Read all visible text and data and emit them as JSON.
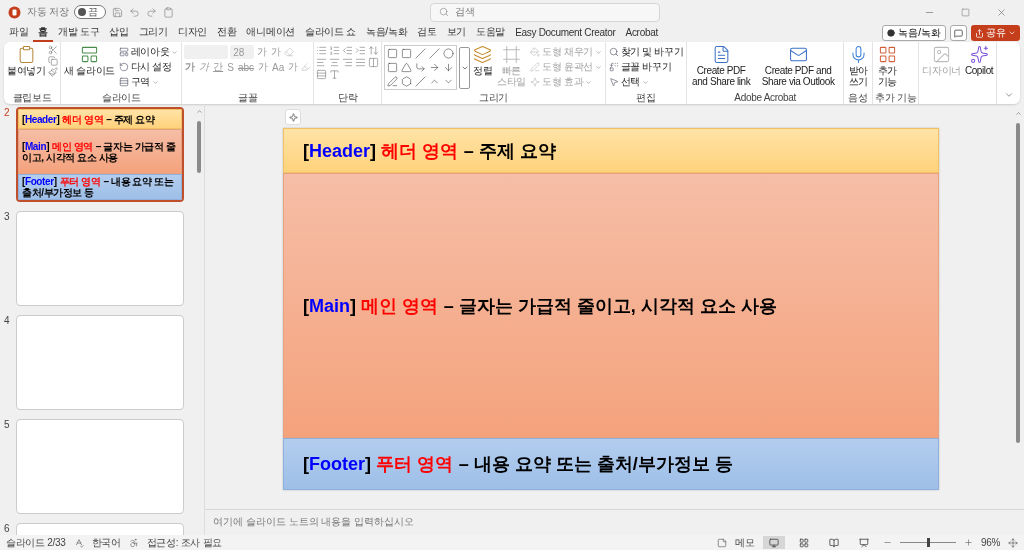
{
  "titlebar": {
    "autosave_label": "자동 저장",
    "autosave": {
      "on": false,
      "label": "끔"
    },
    "search": {
      "placeholder": "검색"
    }
  },
  "menu": [
    {
      "label": "파일",
      "selected": false
    },
    {
      "label": "홈",
      "selected": true
    },
    {
      "label": "개발 도구",
      "selected": false
    },
    {
      "label": "삽입",
      "selected": false
    },
    {
      "label": "그리기",
      "selected": false
    },
    {
      "label": "디자인",
      "selected": false
    },
    {
      "label": "전환",
      "selected": false
    },
    {
      "label": "애니메이션",
      "selected": false
    },
    {
      "label": "슬라이드 쇼",
      "selected": false
    },
    {
      "label": "녹음/녹화",
      "selected": false
    },
    {
      "label": "검토",
      "selected": false
    },
    {
      "label": "보기",
      "selected": false
    },
    {
      "label": "도움말",
      "selected": false
    },
    {
      "label": "Easy Document Creator",
      "selected": false
    },
    {
      "label": "Acrobat",
      "selected": false
    }
  ],
  "top_actions": {
    "record": "녹음/녹화",
    "share": "공유"
  },
  "ribbon": {
    "groups": [
      {
        "kind": "clipboard",
        "label": "클립보드",
        "items": [
          {
            "label": "붙여넣기",
            "disabled": false
          }
        ]
      },
      {
        "kind": "slides",
        "label": "슬라이드",
        "items": [
          {
            "label": "새 슬라이드",
            "disabled": false
          },
          {
            "label": "레이아웃",
            "disabled": false
          },
          {
            "label": "다시 설정",
            "disabled": false
          },
          {
            "label": "구역",
            "disabled": false
          }
        ]
      },
      {
        "kind": "font",
        "label": "글꼴",
        "disabled": true,
        "size": "28",
        "row1": [
          "가",
          "가"
        ],
        "row2": [
          "가",
          "가",
          "간",
          "S",
          "abc",
          "가",
          "Aa",
          "가"
        ]
      },
      {
        "kind": "paragraph",
        "label": "단락"
      },
      {
        "kind": "drawing",
        "label": "그리기",
        "items": [
          {
            "label": "정렬",
            "disabled": false
          },
          {
            "label": "빠른 스타일",
            "disabled": true
          },
          {
            "label": "도형 채우기",
            "disabled": true
          },
          {
            "label": "도형 윤곽선",
            "disabled": true
          },
          {
            "label": "도형 효과",
            "disabled": true
          }
        ]
      },
      {
        "kind": "editing",
        "label": "편집",
        "items": [
          {
            "label": "찾기 및 바꾸기",
            "disabled": false
          },
          {
            "label": "글꼴 바꾸기",
            "disabled": false
          },
          {
            "label": "선택",
            "disabled": false
          }
        ]
      },
      {
        "kind": "acrobat",
        "label": "Adobe Acrobat",
        "items": [
          {
            "label": "Create PDF and Share link",
            "disabled": false
          },
          {
            "label": "Create PDF and Share via Outlook",
            "disabled": false
          }
        ]
      },
      {
        "kind": "voice",
        "label": "음성",
        "items": [
          {
            "label": "받아쓰기",
            "disabled": false
          }
        ]
      },
      {
        "kind": "addins",
        "label": "추가 기능",
        "items": [
          {
            "label": "추가 기능",
            "disabled": false
          }
        ]
      },
      {
        "kind": "ai",
        "items": [
          {
            "label": "디자이너",
            "disabled": true
          },
          {
            "label": "Copilot",
            "disabled": false
          }
        ]
      }
    ]
  },
  "thumbnails": [
    {
      "number": "2",
      "selected": true,
      "sections": [
        {
          "kind": "header",
          "parts": [
            {
              "text": "[",
              "color": "#000000"
            },
            {
              "text": "Header",
              "color": "#0000ff"
            },
            {
              "text": "]",
              "color": "#000000"
            },
            {
              "text": "헤더 영역",
              "color": "#ff0000"
            },
            {
              "text": "– 주제 요약",
              "color": "#000000"
            }
          ]
        },
        {
          "kind": "main",
          "parts": [
            {
              "text": "[",
              "color": "#000000"
            },
            {
              "text": "Main",
              "color": "#0000ff"
            },
            {
              "text": "]",
              "color": "#000000"
            },
            {
              "text": "메인 영역",
              "color": "#ff0000"
            },
            {
              "text": "– 글자는 가급적 줄이고, 시각적 요소 사용",
              "color": "#000000"
            }
          ]
        },
        {
          "kind": "footer",
          "parts": [
            {
              "text": "[",
              "color": "#000000"
            },
            {
              "text": "Footer",
              "color": "#0000ff"
            },
            {
              "text": "]",
              "color": "#000000"
            },
            {
              "text": "푸터 영역",
              "color": "#ff0000"
            },
            {
              "text": "– 내용 요약 또는 출처/부가정보 등",
              "color": "#000000"
            }
          ]
        }
      ]
    },
    {
      "number": "3",
      "selected": false
    },
    {
      "number": "4",
      "selected": false
    },
    {
      "number": "5",
      "selected": false
    },
    {
      "number": "6",
      "selected": false
    }
  ],
  "slide": {
    "sections": [
      {
        "kind": "header",
        "parts": [
          {
            "text": "[",
            "color": "#000000"
          },
          {
            "text": "Header",
            "color": "#0000ff"
          },
          {
            "text": "]",
            "color": "#000000"
          },
          {
            "text": "헤더 영역",
            "color": "#ff0000"
          },
          {
            "text": "– 주제 요약",
            "color": "#000000"
          }
        ]
      },
      {
        "kind": "main",
        "parts": [
          {
            "text": "[",
            "color": "#000000"
          },
          {
            "text": "Main",
            "color": "#0000ff"
          },
          {
            "text": "]",
            "color": "#000000"
          },
          {
            "text": "메인 영역",
            "color": "#ff0000"
          },
          {
            "text": "– 글자는 가급적 줄이고, 시각적 요소 사용",
            "color": "#000000"
          }
        ]
      },
      {
        "kind": "footer",
        "parts": [
          {
            "text": "[",
            "color": "#000000"
          },
          {
            "text": "Footer",
            "color": "#0000ff"
          },
          {
            "text": "]",
            "color": "#000000"
          },
          {
            "text": "푸터 영역",
            "color": "#ff0000"
          },
          {
            "text": "– 내용 요약 또는 출처/부가정보 등",
            "color": "#000000"
          }
        ]
      }
    ]
  },
  "notes": {
    "placeholder": "여기에 슬라이드 노트의 내용을 입력하십시오"
  },
  "status_bar": {
    "slide": "슬라이드 2/33",
    "language": "한국어",
    "accessibility": "접근성: 조사 필요",
    "notes": "메모",
    "views": [
      {
        "selected": true
      },
      {
        "selected": false
      },
      {
        "selected": false
      },
      {
        "selected": false
      }
    ],
    "zoom": {
      "level": 0.5
    },
    "zoom_text": "96%"
  }
}
